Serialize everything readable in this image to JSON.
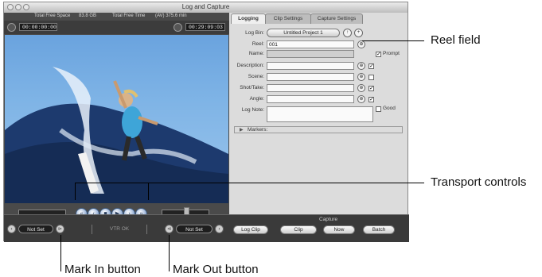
{
  "window": {
    "title": "Log and Capture"
  },
  "viewer": {
    "free_space_label": "Total Free Space",
    "free_space_value": "83.8 GB",
    "free_time_label": "Total Free Time",
    "free_time_value": "(AV) 375.6 min",
    "current_timecode": "00:00:00:00",
    "duration_timecode": "00:29:09:03",
    "vtr_status": "VTR OK",
    "mark_in_value": "Not Set",
    "mark_out_value": "Not Set"
  },
  "tabs": [
    {
      "label": "Logging",
      "active": true
    },
    {
      "label": "Clip Settings",
      "active": false
    },
    {
      "label": "Capture Settings",
      "active": false
    }
  ],
  "logging": {
    "log_bin_label": "Log Bin:",
    "log_bin_value": "Untitled Project 1",
    "reel_label": "Reel:",
    "reel_value": "001",
    "name_label": "Name:",
    "name_value": "",
    "prompt_label": "Prompt",
    "description_label": "Description:",
    "scene_label": "Scene:",
    "shot_take_label": "Shot/Take:",
    "angle_label": "Angle:",
    "log_note_label": "Log Note:",
    "good_label": "Good",
    "markers_label": "Markers:"
  },
  "capture": {
    "section_label": "Capture",
    "log_clip": "Log Clip",
    "clip": "Clip",
    "now": "Now",
    "batch": "Batch"
  },
  "callouts": {
    "reel_field": "Reel field",
    "transport_controls": "Transport controls",
    "mark_in_button": "Mark In button",
    "mark_out_button": "Mark Out button"
  }
}
